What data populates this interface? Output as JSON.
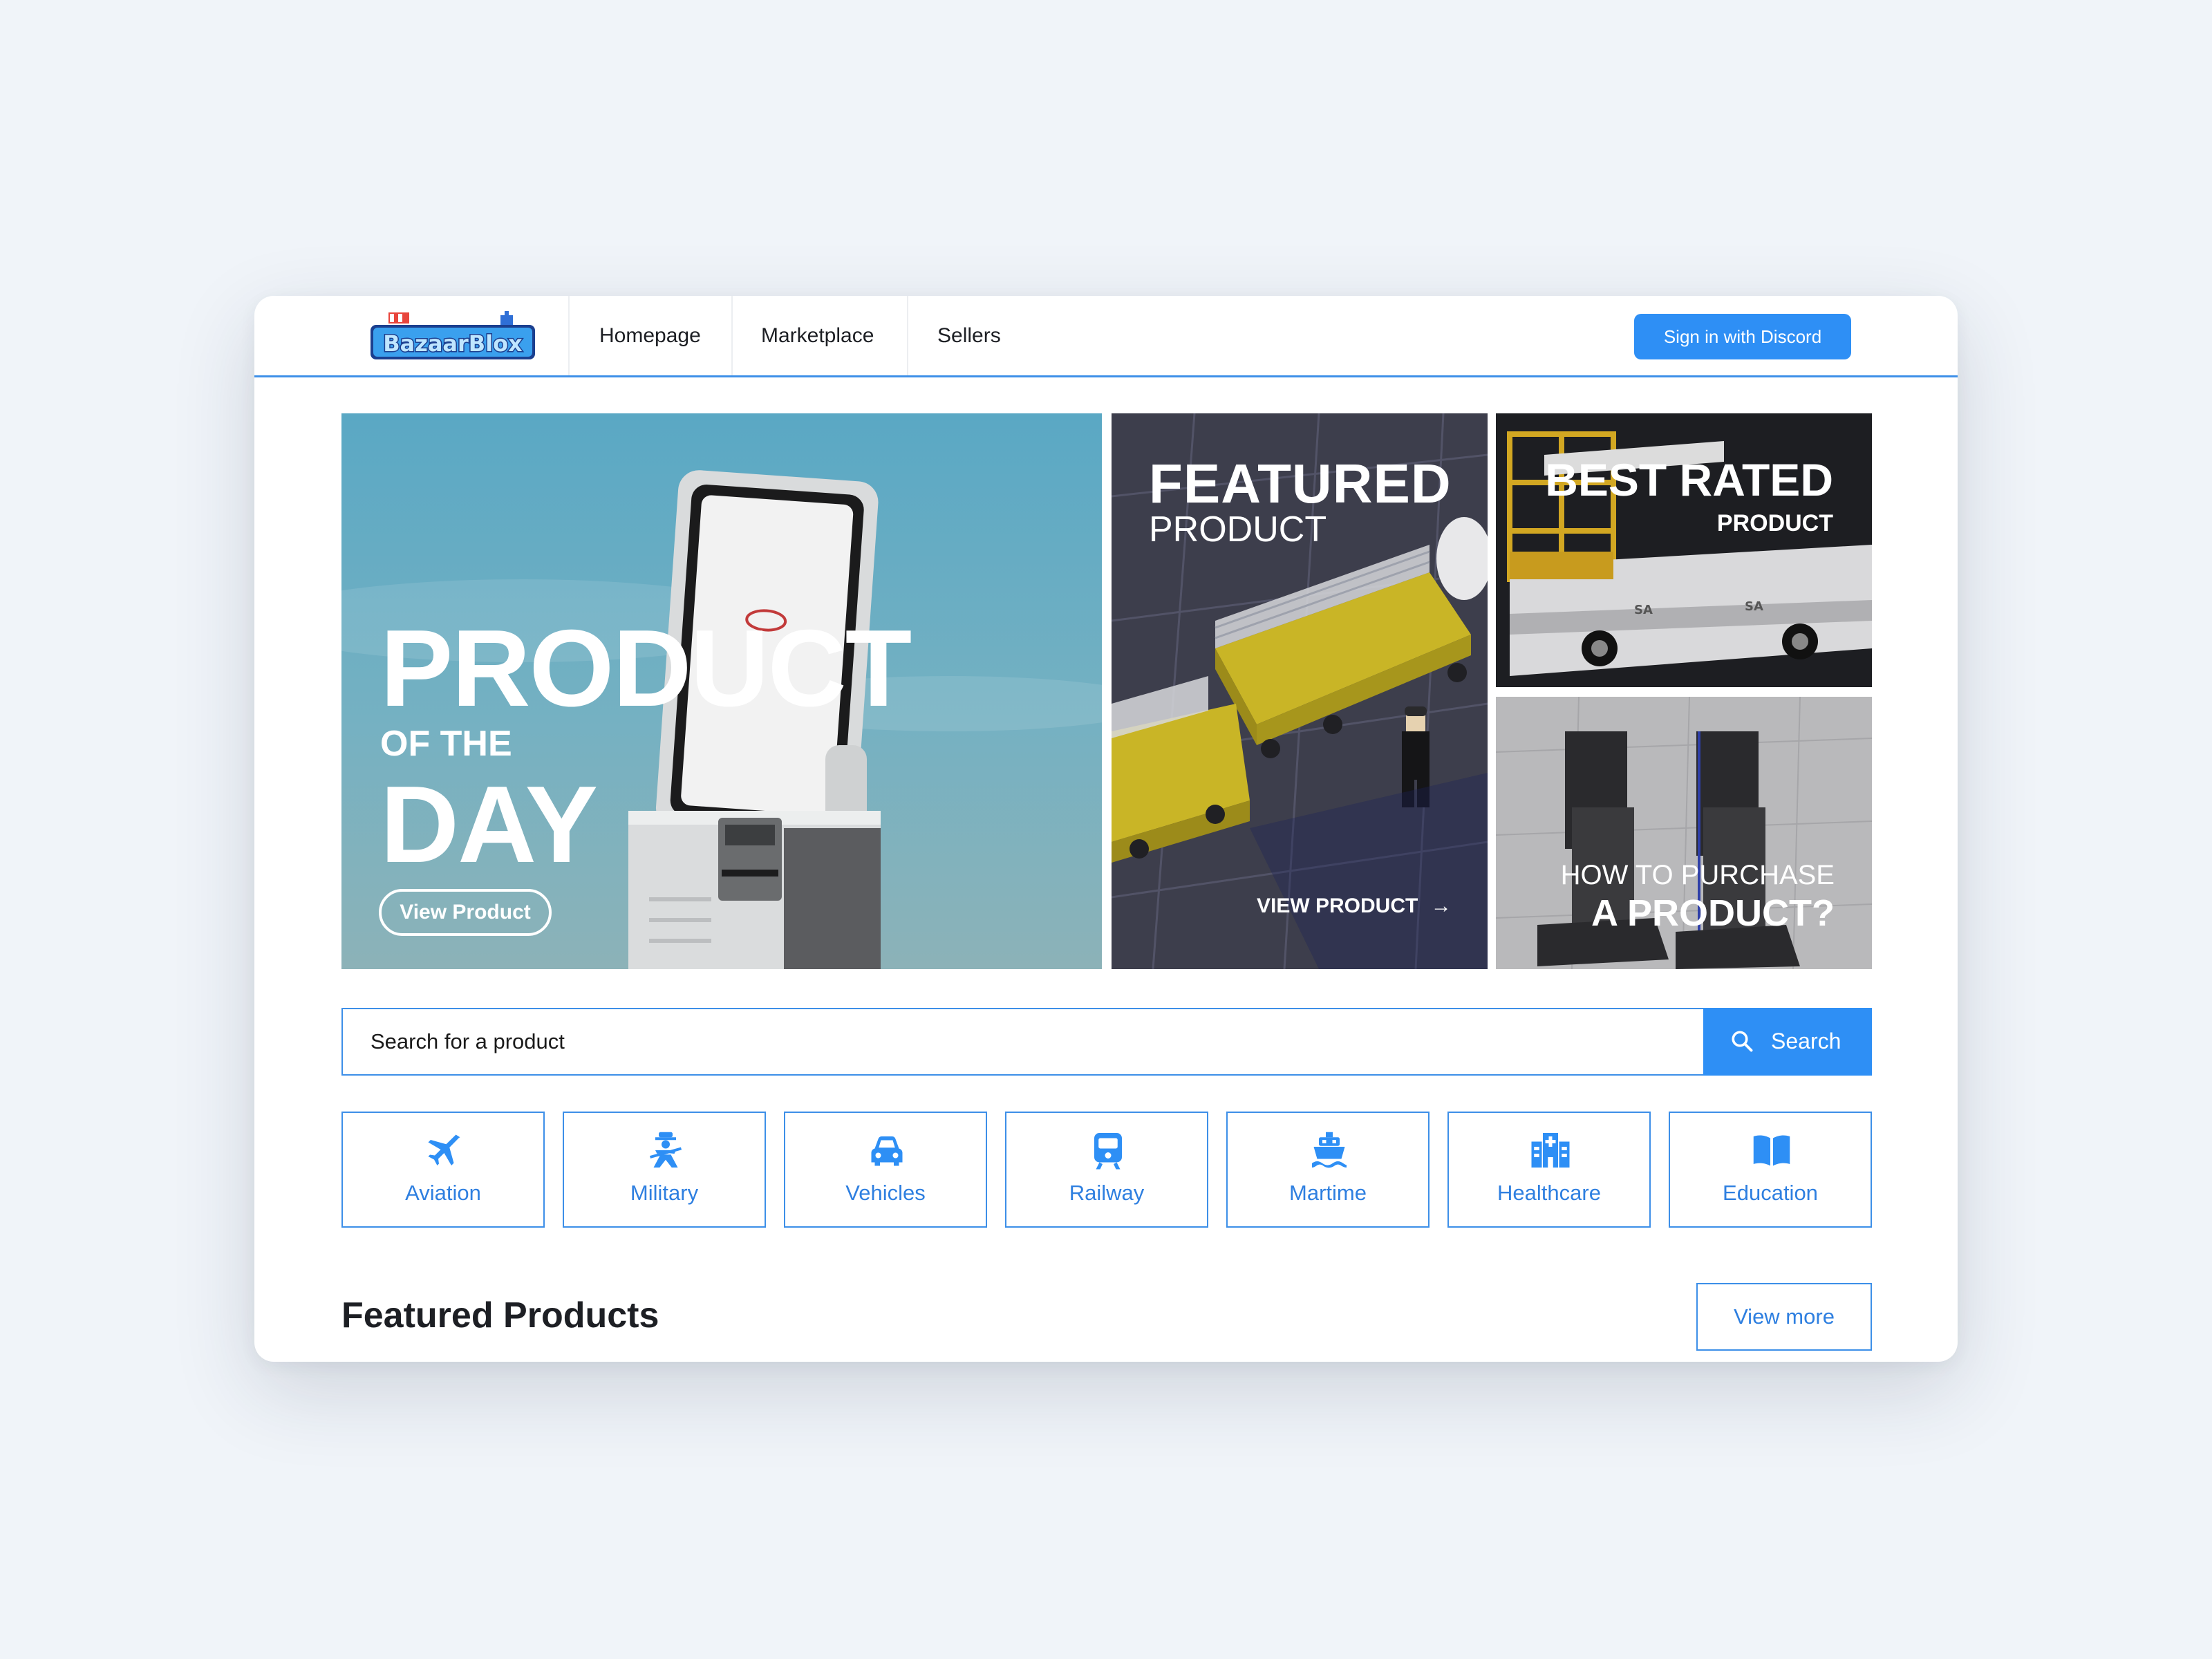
{
  "header": {
    "logo_text": "BazaarBlox",
    "nav": [
      {
        "label": "Homepage"
      },
      {
        "label": "Marketplace"
      },
      {
        "label": "Sellers"
      }
    ],
    "signin_label": "Sign in with Discord"
  },
  "hero": {
    "product_of_day": {
      "line1": "PRODUCT",
      "line2": "OF THE",
      "line3": "DAY",
      "button": "View Product"
    },
    "featured": {
      "title": "FEATURED",
      "subtitle": "PRODUCT",
      "link": "VIEW PRODUCT"
    },
    "best_rated": {
      "title": "BEST RATED",
      "subtitle": "PRODUCT"
    },
    "how_to": {
      "line1": "HOW TO PURCHASE",
      "line2": "A PRODUCT?"
    }
  },
  "search": {
    "placeholder": "Search for a product",
    "button": "Search"
  },
  "categories": [
    {
      "label": "Aviation",
      "icon": "plane-icon"
    },
    {
      "label": "Military",
      "icon": "soldier-icon"
    },
    {
      "label": "Vehicles",
      "icon": "car-icon"
    },
    {
      "label": "Railway",
      "icon": "train-icon"
    },
    {
      "label": "Martime",
      "icon": "ship-icon"
    },
    {
      "label": "Healthcare",
      "icon": "hospital-icon"
    },
    {
      "label": "Education",
      "icon": "book-icon"
    }
  ],
  "featured_products": {
    "title": "Featured Products",
    "view_more": "View more"
  },
  "colors": {
    "accent": "#2e8ff5",
    "border": "#3d8fe8",
    "page_bg": "#f0f4f9"
  }
}
